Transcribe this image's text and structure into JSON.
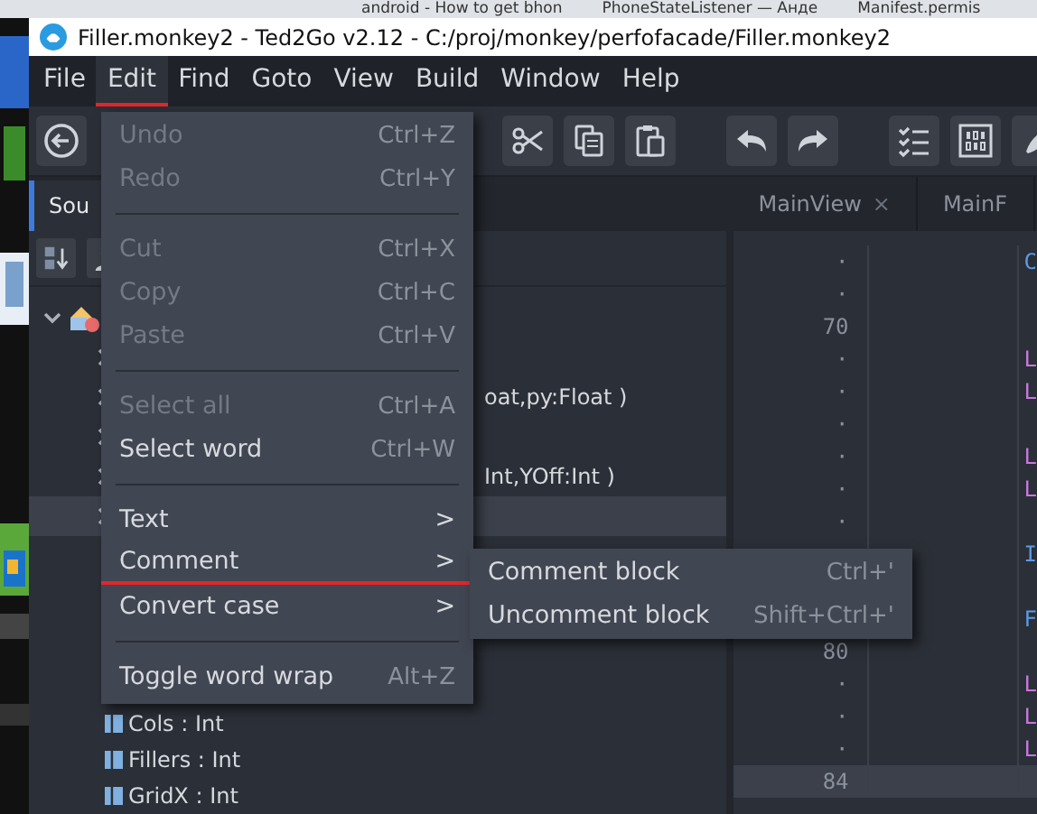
{
  "browser_tabs": [
    {
      "title": "android - How to get bhon"
    },
    {
      "title": "PhoneStateListener — Анде"
    },
    {
      "title": "Manifest.permis"
    }
  ],
  "window": {
    "title": "Filler.monkey2 - Ted2Go v2.12 - C:/proj/monkey/perfofacade/Filler.monkey2"
  },
  "menubar": [
    {
      "label": "File",
      "selected": false
    },
    {
      "label": "Edit",
      "selected": true
    },
    {
      "label": "Find",
      "selected": false
    },
    {
      "label": "Goto",
      "selected": false
    },
    {
      "label": "View",
      "selected": false
    },
    {
      "label": "Build",
      "selected": false
    },
    {
      "label": "Window",
      "selected": false
    },
    {
      "label": "Help",
      "selected": false
    }
  ],
  "side_tabs": [
    {
      "label": "Sou",
      "selected": true
    }
  ],
  "editor_tabs": [
    {
      "label": "MainView",
      "close": "×"
    },
    {
      "label": "MainF"
    }
  ],
  "tree": {
    "rows": [
      {
        "kind": "root",
        "expanded": true,
        "selected": false
      },
      {
        "kind": "folder",
        "expanded": false,
        "selected": false
      },
      {
        "kind": "folder",
        "expanded": false,
        "selected": false,
        "tail": "oat,py:Float )"
      },
      {
        "kind": "folder",
        "expanded": false,
        "selected": false
      },
      {
        "kind": "folder",
        "expanded": false,
        "selected": false,
        "tail": "Int,YOff:Int )"
      },
      {
        "kind": "folder",
        "expanded": false,
        "selected": true
      }
    ],
    "fields": [
      {
        "label": "Cols : Int"
      },
      {
        "label": "Fillers : Int"
      },
      {
        "label": "GridX : Int"
      }
    ]
  },
  "editor_lines": [
    {
      "gutter": "·",
      "code": "C",
      "color": "#5b9be6",
      "current": false
    },
    {
      "gutter": "·",
      "current": false
    },
    {
      "gutter": "70",
      "current": false
    },
    {
      "gutter": "·",
      "code": "L",
      "color": "#c678dd",
      "current": false
    },
    {
      "gutter": "·",
      "code": "L",
      "color": "#c678dd",
      "current": false
    },
    {
      "gutter": "·",
      "current": false
    },
    {
      "gutter": "·",
      "code": "L",
      "color": "#c678dd",
      "current": false
    },
    {
      "gutter": "·",
      "code": "L",
      "color": "#c678dd",
      "current": false
    },
    {
      "gutter": "·",
      "current": false
    },
    {
      "code": "I",
      "color": "#5b9be6",
      "current": false
    },
    {
      "current": false
    },
    {
      "code": "F",
      "color": "#5b9be6",
      "current": false
    },
    {
      "gutter": "80",
      "current": false
    },
    {
      "gutter": "·",
      "code": "L",
      "color": "#c678dd",
      "current": false
    },
    {
      "gutter": "·",
      "code": "L",
      "color": "#c678dd",
      "current": false
    },
    {
      "gutter": "·",
      "code": "L",
      "color": "#c678dd",
      "current": false
    },
    {
      "gutter": "84",
      "current": true
    }
  ],
  "edit_menu": [
    {
      "kind": "item",
      "label": "Undo",
      "shortcut": "Ctrl+Z",
      "disabled": true
    },
    {
      "kind": "item",
      "label": "Redo",
      "shortcut": "Ctrl+Y",
      "disabled": true
    },
    {
      "kind": "separator"
    },
    {
      "kind": "item",
      "label": "Cut",
      "shortcut": "Ctrl+X",
      "disabled": true
    },
    {
      "kind": "item",
      "label": "Copy",
      "shortcut": "Ctrl+C",
      "disabled": true
    },
    {
      "kind": "item",
      "label": "Paste",
      "shortcut": "Ctrl+V",
      "disabled": true
    },
    {
      "kind": "separator"
    },
    {
      "kind": "item",
      "label": "Select all",
      "shortcut": "Ctrl+A",
      "disabled": true
    },
    {
      "kind": "item",
      "label": "Select word",
      "shortcut": "Ctrl+W",
      "disabled": false
    },
    {
      "kind": "separator"
    },
    {
      "kind": "submenu",
      "label": "Text",
      "arrow": ">",
      "underlined": false
    },
    {
      "kind": "submenu",
      "label": "Comment",
      "arrow": ">",
      "underlined": true
    },
    {
      "kind": "submenu",
      "label": "Convert case",
      "arrow": ">",
      "underlined": false
    },
    {
      "kind": "separator"
    },
    {
      "kind": "item",
      "label": "Toggle word wrap",
      "shortcut": "Alt+Z",
      "disabled": false
    }
  ],
  "comment_submenu": [
    {
      "label": "Comment block",
      "shortcut": "Ctrl+'"
    },
    {
      "label": "Uncomment block",
      "shortcut": "Shift+Ctrl+'"
    }
  ]
}
